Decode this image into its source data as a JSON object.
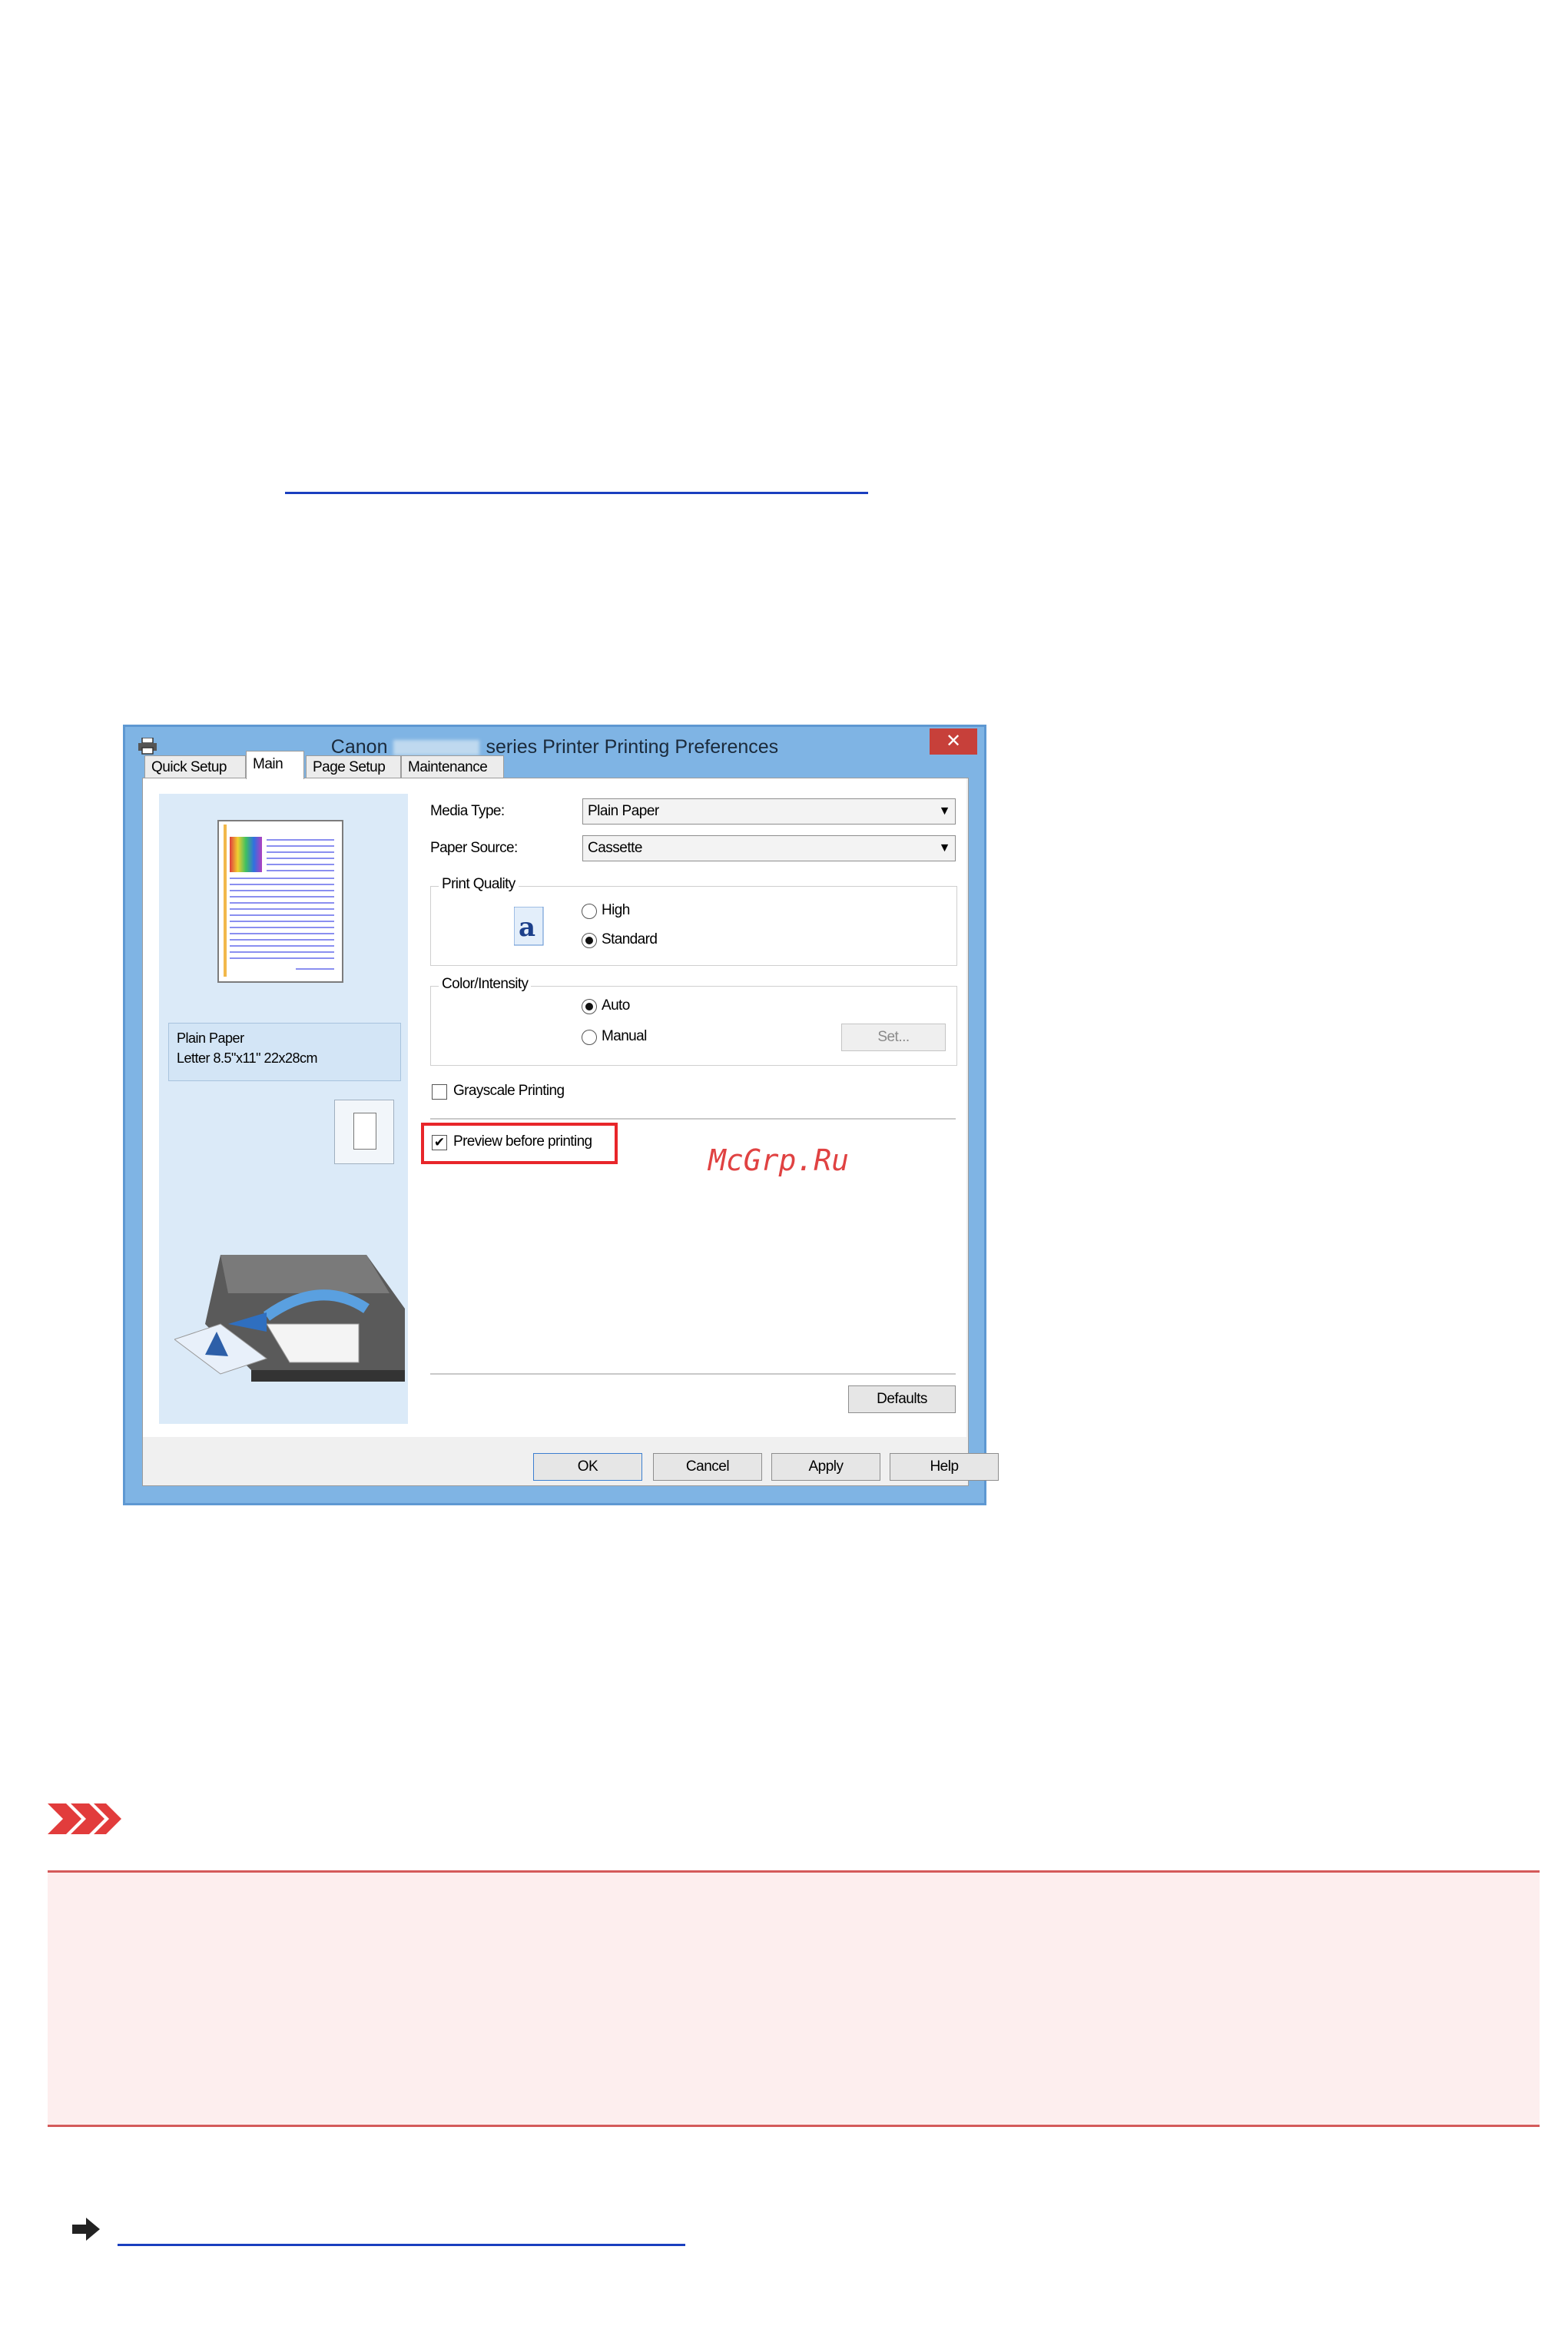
{
  "dialog": {
    "title_prefix": "Canon",
    "title_suffix": "series Printer Printing Preferences",
    "close_label": "✕",
    "tabs": [
      "Quick Setup",
      "Main",
      "Page Setup",
      "Maintenance"
    ],
    "info_line1": "Plain Paper",
    "info_line2": "Letter 8.5\"x11\" 22x28cm",
    "media_type_label": "Media Type:",
    "media_type_value": "Plain Paper",
    "paper_source_label": "Paper Source:",
    "paper_source_value": "Cassette",
    "print_quality_title": "Print Quality",
    "quality_high": "High",
    "quality_standard": "Standard",
    "color_title": "Color/Intensity",
    "color_auto": "Auto",
    "color_manual": "Manual",
    "set_button": "Set...",
    "grayscale_label": "Grayscale Printing",
    "preview_label": "Preview before printing",
    "defaults_button": "Defaults",
    "ok_button": "OK",
    "cancel_button": "Cancel",
    "apply_button": "Apply",
    "help_button": "Help"
  },
  "watermark": "McGrp.Ru",
  "colors": {
    "link": "#1a3fbf",
    "highlight": "#e8262a",
    "important_bg": "#fdeeee",
    "important_border": "#d45a5a",
    "dialog_frame": "#7fb4e4"
  },
  "icons": {
    "important": "double-chevron-right-icon",
    "arrow": "right-arrow-icon",
    "printer": "printer-icon"
  }
}
